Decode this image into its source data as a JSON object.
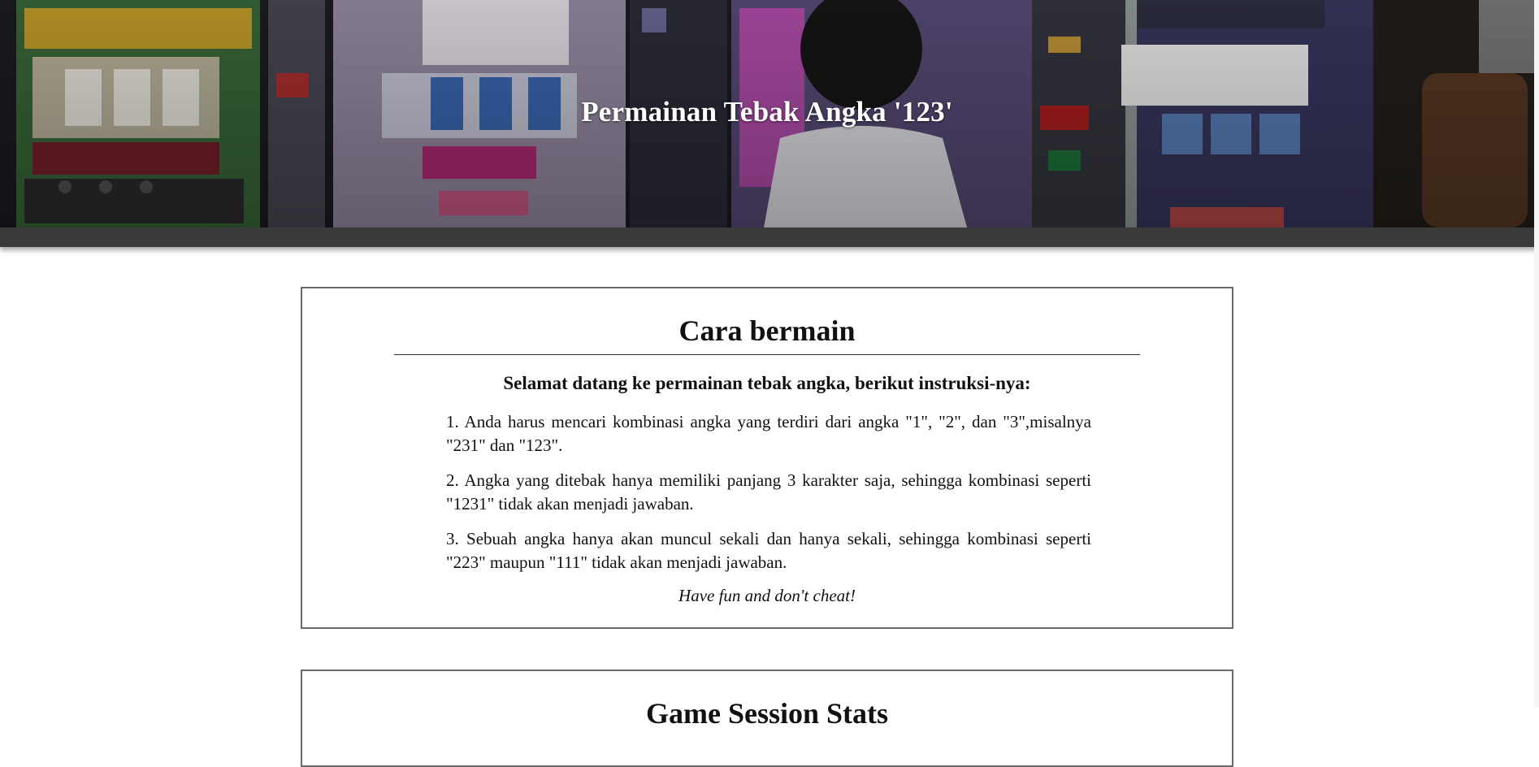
{
  "header": {
    "title": "Permainan Tebak Angka '123'"
  },
  "rules": {
    "heading": "Cara bermain",
    "intro": "Selamat datang ke permainan tebak angka, berikut instruksi-nya:",
    "items": [
      "1. Anda harus mencari kombinasi angka yang terdiri dari angka \"1\", \"2\", dan \"3\",misalnya \"231\" dan \"123\".",
      "2. Angka yang ditebak hanya memiliki panjang 3 karakter saja, sehingga kombinasi seperti \"1231\" tidak akan menjadi jawaban.",
      "3. Sebuah angka hanya akan muncul sekali dan hanya sekali, sehingga kombinasi seperti \"223\" maupun \"111\" tidak akan menjadi jawaban."
    ],
    "closing": "Have fun and don't cheat!"
  },
  "stats": {
    "heading": "Game Session Stats"
  }
}
